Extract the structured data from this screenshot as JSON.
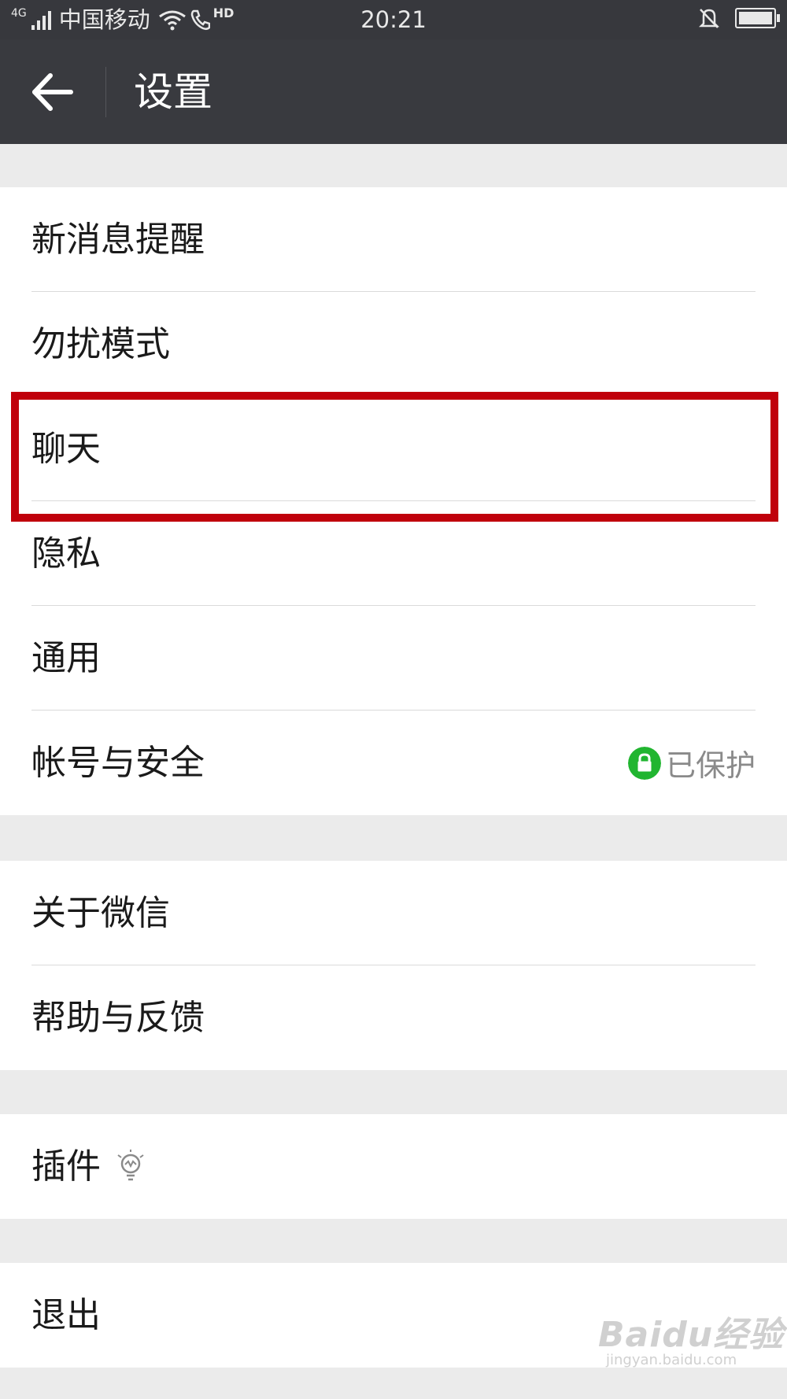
{
  "status_bar": {
    "network_type": "4G",
    "carrier": "中国移动",
    "call_indicator": "HD",
    "time": "20:21",
    "icons": [
      "signal-icon",
      "wifi-icon",
      "hd-call-icon",
      "bell-off-icon",
      "battery-icon"
    ]
  },
  "header": {
    "title": "设置",
    "back_icon": "arrow-left-icon"
  },
  "groups": [
    {
      "items": [
        {
          "label": "新消息提醒"
        },
        {
          "label": "勿扰模式"
        },
        {
          "label": "聊天",
          "highlighted": true
        },
        {
          "label": "隐私"
        },
        {
          "label": "通用"
        },
        {
          "label": "帐号与安全",
          "status": "已保护",
          "status_icon": "lock-icon"
        }
      ]
    },
    {
      "items": [
        {
          "label": "关于微信"
        },
        {
          "label": "帮助与反馈"
        }
      ]
    },
    {
      "items": [
        {
          "label": "插件",
          "icon": "lightbulb-icon"
        }
      ]
    },
    {
      "items": [
        {
          "label": "退出"
        }
      ]
    }
  ],
  "highlight_color": "#c0000b",
  "accent_green": "#21b530",
  "watermark": {
    "main": "Baidu经验",
    "sub": "jingyan.baidu.com"
  }
}
